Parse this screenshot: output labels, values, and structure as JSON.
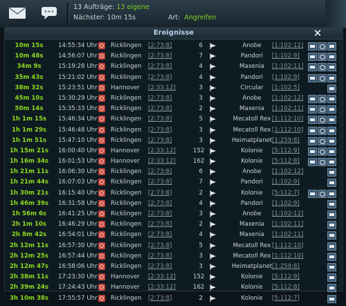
{
  "top": {
    "auftraege": "13 Aufträge:",
    "eigene": "13 eigene",
    "naechster_label": "Nächster:",
    "naechster_value": "10m 15s",
    "art_label": "Art:",
    "art_value": "Angreifen"
  },
  "panel": {
    "title": "Ereignisse",
    "close": "✕"
  },
  "events": [
    {
      "time": "10m 15s",
      "clock": "14:55:34 Uhr",
      "planet": "Ricklingen",
      "coord": "[2:73:8]",
      "ships": "6",
      "target": "Anobe",
      "tcoord": "[1:102:12]",
      "buttons": 3
    },
    {
      "time": "10m 48s",
      "clock": "14:56:07 Uhr",
      "planet": "Ricklingen",
      "coord": "[2:73:8]",
      "ships": "7",
      "target": "Pandori",
      "tcoord": "[1:102:9]",
      "buttons": 3
    },
    {
      "time": "34m 9s",
      "clock": "15:19:28 Uhr",
      "planet": "Ricklingen",
      "coord": "[2:73:8]",
      "ships": "4",
      "target": "Maxenia",
      "tcoord": "[1:102:11]",
      "buttons": 3
    },
    {
      "time": "35m 43s",
      "clock": "15:21:02 Uhr",
      "planet": "Ricklingen",
      "coord": "[2:73:8]",
      "ships": "4",
      "target": "Pandori",
      "tcoord": "[1:102:9]",
      "buttons": 3
    },
    {
      "time": "38m 32s",
      "clock": "15:23:51 Uhr",
      "planet": "Hannover",
      "coord": "[2:33:12]",
      "ships": "3",
      "target": "Circular",
      "tcoord": "[1:102:5]",
      "buttons": 1
    },
    {
      "time": "45m 10s",
      "clock": "15:30:29 Uhr",
      "planet": "Ricklingen",
      "coord": "[2:73:8]",
      "ships": "3",
      "target": "Anobe",
      "tcoord": "[1:102:12]",
      "buttons": 3
    },
    {
      "time": "50m 14s",
      "clock": "15:35:33 Uhr",
      "planet": "Ricklingen",
      "coord": "[2:73:8]",
      "ships": "2",
      "target": "Maxenia",
      "tcoord": "[1:102:11]",
      "buttons": 3
    },
    {
      "time": "1h 1m 15s",
      "clock": "15:46:34 Uhr",
      "planet": "Ricklingen",
      "coord": "[2:73:8]",
      "ships": "5",
      "target": "Mecatoll Rex",
      "tcoord": "[1:112:10]",
      "buttons": 3
    },
    {
      "time": "1h 1m 29s",
      "clock": "15:46:48 Uhr",
      "planet": "Ricklingen",
      "coord": "[2:73:8]",
      "ships": "3",
      "target": "Mecatoll Rex",
      "tcoord": "[1:112:10]",
      "buttons": 3
    },
    {
      "time": "1h 1m 51s",
      "clock": "15:47:10 Uhr",
      "planet": "Ricklingen",
      "coord": "[2:73:8]",
      "ships": "3",
      "target": "Heimatplanet",
      "tcoord": "[1:259:8]",
      "buttons": 3
    },
    {
      "time": "1h 15m 21s",
      "clock": "16:00:40 Uhr",
      "planet": "Hannover",
      "coord": "[2:33:12]",
      "ships": "152",
      "target": "Kolonie",
      "tcoord": "[5:112:9]",
      "buttons": 3
    },
    {
      "time": "1h 16m 34s",
      "clock": "16:01:53 Uhr",
      "planet": "Hannover",
      "coord": "[2:33:12]",
      "ships": "162",
      "target": "Kolonie",
      "tcoord": "[5:112:8]",
      "buttons": 3
    },
    {
      "time": "1h 21m 11s",
      "clock": "16:06:30 Uhr",
      "planet": "Ricklingen",
      "coord": "[2:73:8]",
      "ships": "6",
      "target": "Anobe",
      "tcoord": "[1:102:12]",
      "buttons": 1
    },
    {
      "time": "1h 21m 44s",
      "clock": "16:07:03 Uhr",
      "planet": "Ricklingen",
      "coord": "[2:73:8]",
      "ships": "7",
      "target": "Pandori",
      "tcoord": "[1:102:9]",
      "buttons": 1
    },
    {
      "time": "1h 30m 21s",
      "clock": "16:15:40 Uhr",
      "planet": "Ricklingen",
      "coord": "[2:73:8]",
      "ships": "2",
      "target": "Kolonie",
      "tcoord": "[5:112:7]",
      "buttons": 3
    },
    {
      "time": "1h 46m 39s",
      "clock": "16:31:58 Uhr",
      "planet": "Ricklingen",
      "coord": "[2:73:8]",
      "ships": "4",
      "target": "Pandori",
      "tcoord": "[1:102:9]",
      "buttons": 1
    },
    {
      "time": "1h 56m 6s",
      "clock": "16:41:25 Uhr",
      "planet": "Ricklingen",
      "coord": "[2:73:8]",
      "ships": "3",
      "target": "Anobe",
      "tcoord": "[1:102:12]",
      "buttons": 1
    },
    {
      "time": "2h 1m 10s",
      "clock": "16:46:29 Uhr",
      "planet": "Ricklingen",
      "coord": "[2:73:8]",
      "ships": "2",
      "target": "Maxenia",
      "tcoord": "[1:102:11]",
      "buttons": 1
    },
    {
      "time": "2h 8m 42s",
      "clock": "16:54:01 Uhr",
      "planet": "Ricklingen",
      "coord": "[2:73:8]",
      "ships": "4",
      "target": "Maxenia",
      "tcoord": "[1:102:11]",
      "buttons": 1
    },
    {
      "time": "2h 12m 11s",
      "clock": "16:57:30 Uhr",
      "planet": "Ricklingen",
      "coord": "[2:73:8]",
      "ships": "5",
      "target": "Mecatoll Rex",
      "tcoord": "[1:112:10]",
      "buttons": 1
    },
    {
      "time": "2h 12m 25s",
      "clock": "16:57:44 Uhr",
      "planet": "Ricklingen",
      "coord": "[2:73:8]",
      "ships": "3",
      "target": "Mecatoll Rex",
      "tcoord": "[1:112:10]",
      "buttons": 1
    },
    {
      "time": "2h 12m 47s",
      "clock": "16:58:06 Uhr",
      "planet": "Ricklingen",
      "coord": "[2:73:8]",
      "ships": "3",
      "target": "Heimatplanet",
      "tcoord": "[1:259:8]",
      "buttons": 1
    },
    {
      "time": "2h 38m 11s",
      "clock": "17:23:30 Uhr",
      "planet": "Hannover",
      "coord": "[2:33:12]",
      "ships": "152",
      "target": "Kolonie",
      "tcoord": "[5:112:9]",
      "buttons": 1
    },
    {
      "time": "2h 39m 24s",
      "clock": "17:24:43 Uhr",
      "planet": "Hannover",
      "coord": "[2:33:12]",
      "ships": "162",
      "target": "Kolonie",
      "tcoord": "[5:112:8]",
      "buttons": 1
    },
    {
      "time": "3h 10m 38s",
      "clock": "17:55:57 Uhr",
      "planet": "Ricklingen",
      "coord": "[2:73:8]",
      "ships": "2",
      "target": "Kolonie",
      "tcoord": "[5:112:7]",
      "buttons": 1
    }
  ]
}
